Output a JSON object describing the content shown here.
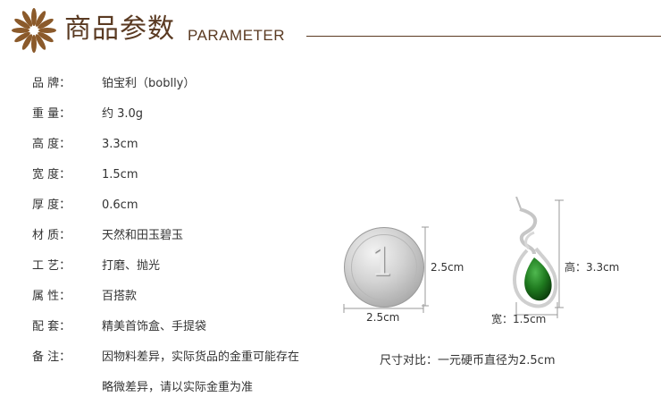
{
  "header": {
    "title_cn": "商品参数",
    "title_en": "PARAMETER"
  },
  "specs": [
    {
      "label": "品  牌：",
      "value": "铂宝利（boblly）"
    },
    {
      "label": "重  量：",
      "value": "约 3.0g"
    },
    {
      "label": "高  度：",
      "value": "3.3cm"
    },
    {
      "label": "宽  度：",
      "value": "1.5cm"
    },
    {
      "label": "厚  度：",
      "value": "0.6cm"
    },
    {
      "label": "材  质：",
      "value": "天然和田玉碧玉"
    },
    {
      "label": "工  艺：",
      "value": "打磨、抛光"
    },
    {
      "label": "属  性：",
      "value": "百搭款"
    },
    {
      "label": "配  套：",
      "value": "精美首饰盒、手提袋"
    },
    {
      "label": "备  注：",
      "value": "因物料差异，实际货品的金重可能存在"
    },
    {
      "label": "",
      "value": "略微差异，请以实际金重为准"
    }
  ],
  "coin": {
    "numeral": "1",
    "height_label": "2.5cm",
    "width_label": "2.5cm"
  },
  "pendant": {
    "height_label": "高：3.3cm",
    "width_label": "宽：1.5cm"
  },
  "size_note": "尺寸对比：一元硬币直径为2.5cm",
  "colors": {
    "brown": "#5a3a22",
    "logo": "#8b5a2b",
    "jade": "#1f7a1f",
    "silver": "#c8c8c8"
  }
}
